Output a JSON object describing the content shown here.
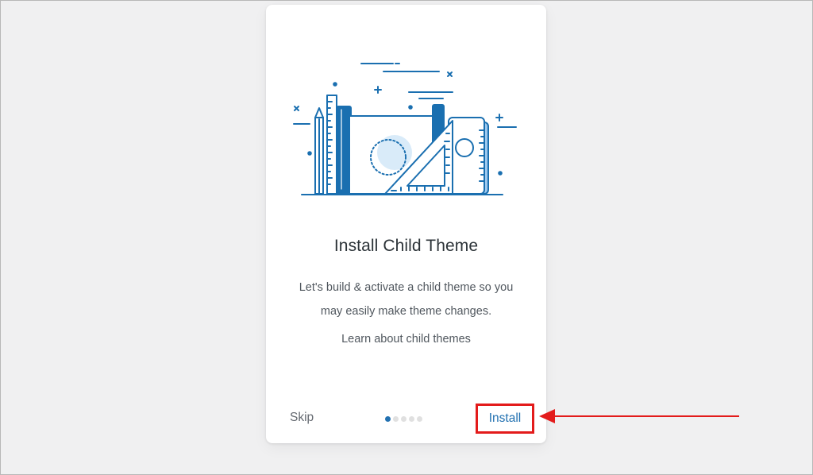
{
  "card": {
    "title": "Install Child Theme",
    "description": "Let's build & activate a child theme so you may easily make theme changes.",
    "learn_link": "Learn about child themes"
  },
  "footer": {
    "skip_label": "Skip",
    "install_label": "Install",
    "steps_total": 5,
    "current_step": 1
  },
  "colors": {
    "accent": "#2271b1",
    "highlight": "#e31b1b",
    "illustration_light": "#9cc8ee"
  },
  "icons": [
    "design-tools-illustration",
    "arrow-annotation"
  ]
}
